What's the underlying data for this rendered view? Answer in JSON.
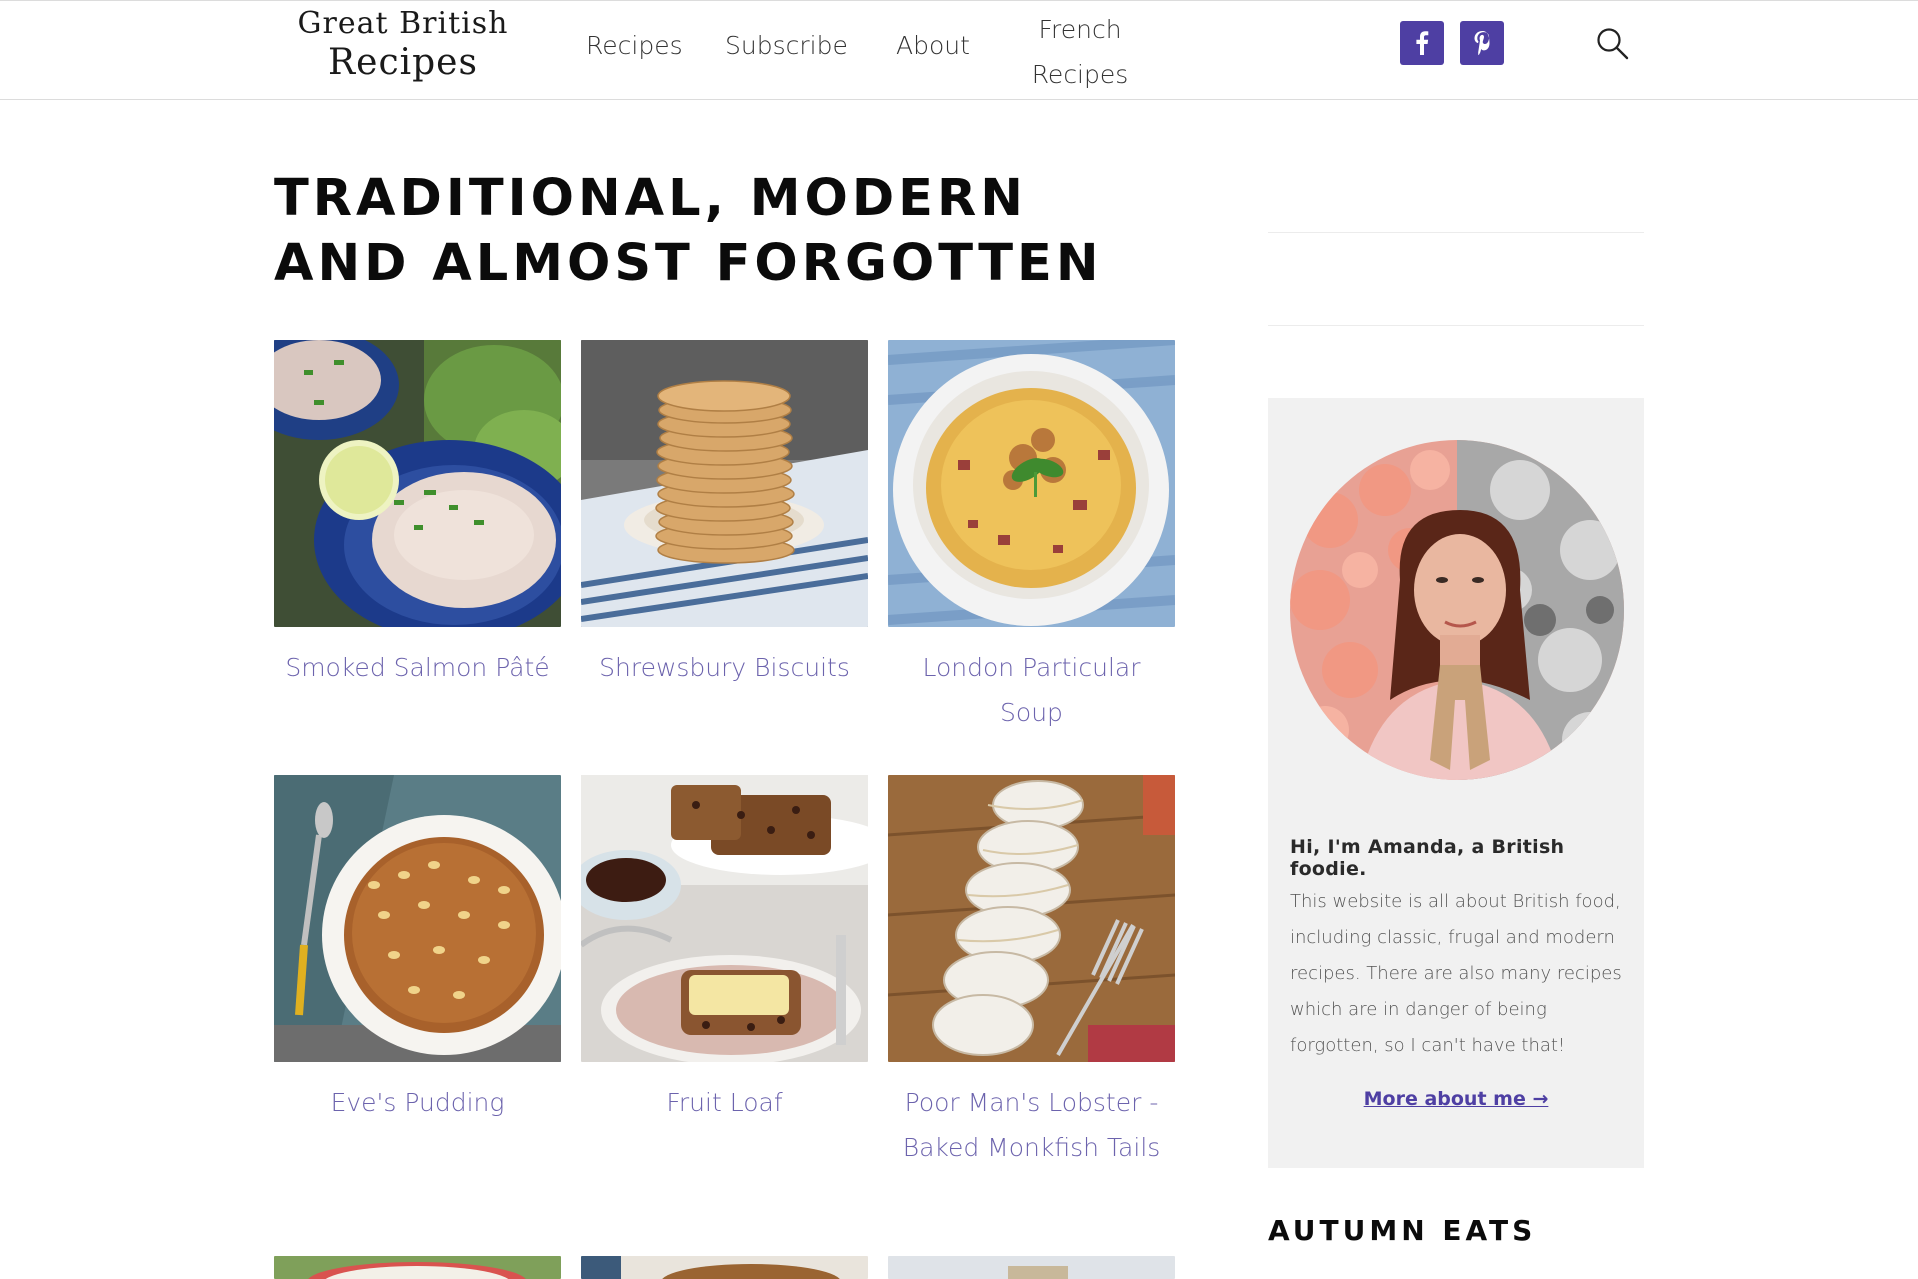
{
  "header": {
    "logo_line1": "Great British",
    "logo_line2": "Recipes",
    "nav": [
      "Recipes",
      "Subscribe",
      "About",
      "French Recipes"
    ],
    "social": [
      "facebook-icon",
      "pinterest-icon"
    ],
    "search_icon": "search-icon",
    "accent": "#4e3fa3"
  },
  "main": {
    "title": "TRADITIONAL, MODERN AND ALMOST FORGOTTEN",
    "recipes": [
      {
        "title": "Smoked Salmon Pâté"
      },
      {
        "title": "Shrewsbury Biscuits"
      },
      {
        "title": "London Particular Soup"
      },
      {
        "title": "Eve's Pudding"
      },
      {
        "title": "Fruit Loaf"
      },
      {
        "title": "Poor Man's Lobster - Baked Monkfish Tails"
      }
    ],
    "link_color": "#6c63ad"
  },
  "sidebar": {
    "about_heading": "Hi, I'm Amanda, a British foodie.",
    "about_text": "This website is all about British food, including classic, frugal and modern recipes. There are also many recipes which are in danger of being forgotten, so I can't have that!",
    "about_link": "More about me →",
    "section_heading": "AUTUMN EATS"
  }
}
